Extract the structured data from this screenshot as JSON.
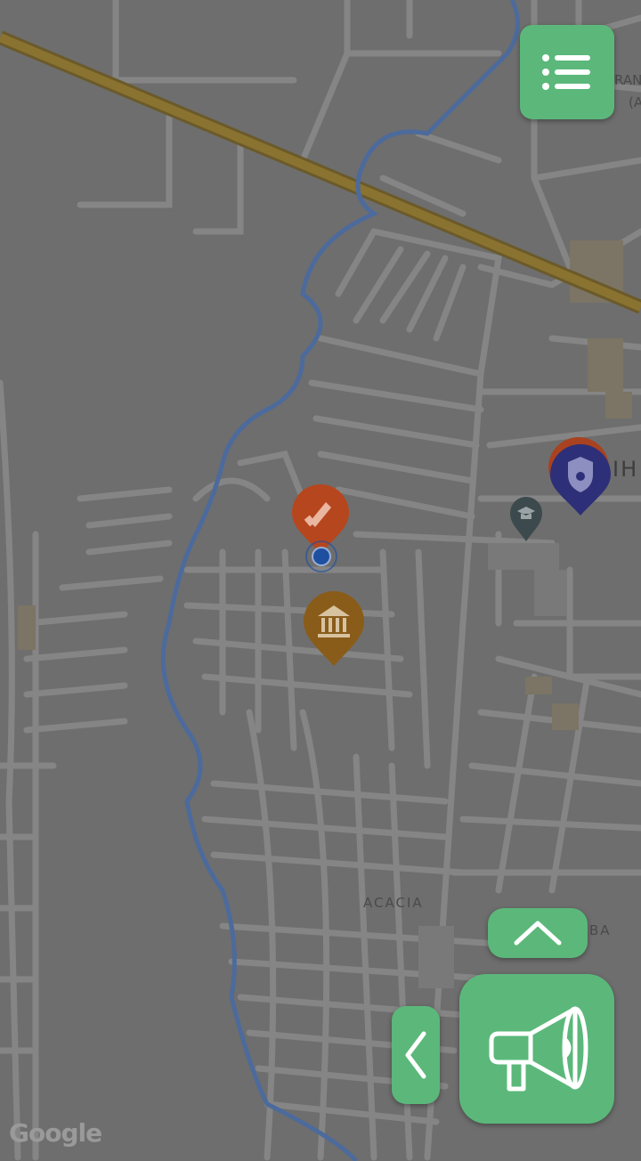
{
  "map": {
    "labels": {
      "acacia": "ACACIA",
      "ba": "BA",
      "ih": "IH",
      "ran": "RAN",
      "paren": "(A"
    },
    "attribution": "Google"
  },
  "markers": [
    {
      "name": "report-marker",
      "icon": "megaphone-icon",
      "color": "#b6461e"
    },
    {
      "name": "government-marker",
      "icon": "bank-icon",
      "color": "#8a5c1a"
    },
    {
      "name": "police-marker",
      "icon": "police-shield-icon",
      "color": "#2d2f78"
    },
    {
      "name": "school-marker",
      "icon": "graduation-cap-icon",
      "color": "#3d4a4d"
    },
    {
      "name": "current-location",
      "icon": "location-dot-icon",
      "color": "#1e4fa0"
    }
  ],
  "controls": {
    "menu": "list-menu-icon",
    "expand": "chevron-up-icon",
    "back": "chevron-left-icon",
    "report": "megaphone-icon",
    "accent": "#5bb87a"
  }
}
